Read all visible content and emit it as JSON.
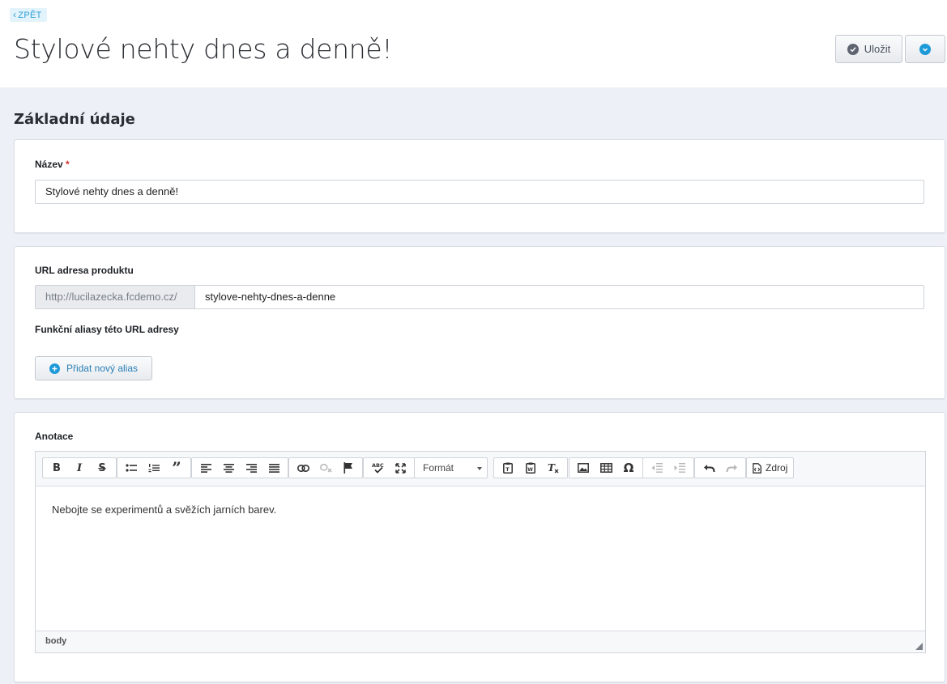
{
  "header": {
    "back_label": "ZPĚT",
    "title": "Stylové nehty dnes a denně!",
    "save_label": "Uložit"
  },
  "section": {
    "title": "Základní údaje"
  },
  "name_card": {
    "label": "Název",
    "required_mark": "*",
    "value": "Stylové nehty dnes a denně!"
  },
  "url_card": {
    "label": "URL adresa produktu",
    "prefix": "http://lucilazecka.fcdemo.cz/",
    "slug": "stylove-nehty-dnes-a-denne",
    "aliases_label": "Funkční aliasy této URL adresy",
    "add_alias_label": "Přidat nový alias"
  },
  "annotation_card": {
    "label": "Anotace",
    "toolbar": {
      "format_label": "Formát",
      "source_label": "Zdroj"
    },
    "content": "Nebojte se experimentů a svěžích jarních barev.",
    "status_path": "body"
  },
  "colors": {
    "accent": "#1d9ad8",
    "background": "#edf0f6",
    "required": "#d0312d"
  }
}
